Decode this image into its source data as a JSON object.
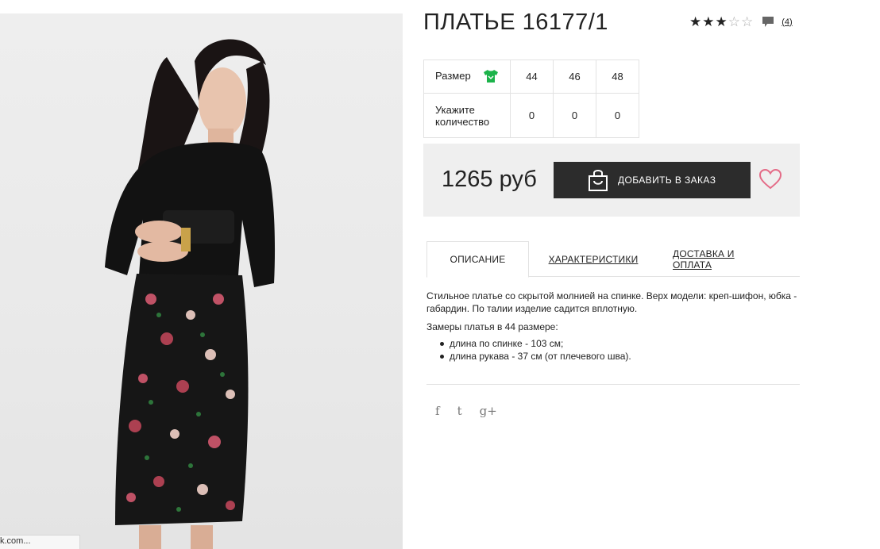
{
  "product": {
    "title": "ПЛАТЬЕ 16177/1",
    "rating_full": 3,
    "rating_total": 5,
    "review_count": "(4)",
    "price": "1265 руб",
    "add_to_order_label": "ДОБАВИТЬ В ЗАКАЗ"
  },
  "size_table": {
    "size_label": "Размер",
    "qty_label_line1": "Укажите",
    "qty_label_line2": "количество",
    "sizes": [
      "44",
      "46",
      "48"
    ],
    "quantities": [
      "0",
      "0",
      "0"
    ]
  },
  "tabs": {
    "description": "ОПИСАНИЕ",
    "characteristics": "ХАРАКТЕРИСТИКИ",
    "delivery": "ДОСТАВКА И ОПЛАТА"
  },
  "description": {
    "paragraph": "Стильное платье со скрытой молнией на спинке. Верх модели: креп-шифон, юбка - габардин. По талии изделие садится вплотную.",
    "measurements_heading": "Замеры платья в 44 размере:",
    "items": [
      "длина по спинке - 103 см;",
      "длина рукава - 37 см (от плечевого шва)."
    ]
  },
  "social": {
    "facebook": "f",
    "twitter": "t",
    "google": "g+"
  },
  "status_bar": {
    "url": "k.com..."
  },
  "icons": {
    "size_chart": "shirt-icon",
    "comments": "comment-icon",
    "cart": "shopping-bag-icon",
    "wishlist": "heart-icon"
  },
  "colors": {
    "accent_green": "#1cb34a",
    "button_dark": "#2c2c2c",
    "heart_pink": "#e46b87",
    "buy_block_bg": "#efefef"
  }
}
